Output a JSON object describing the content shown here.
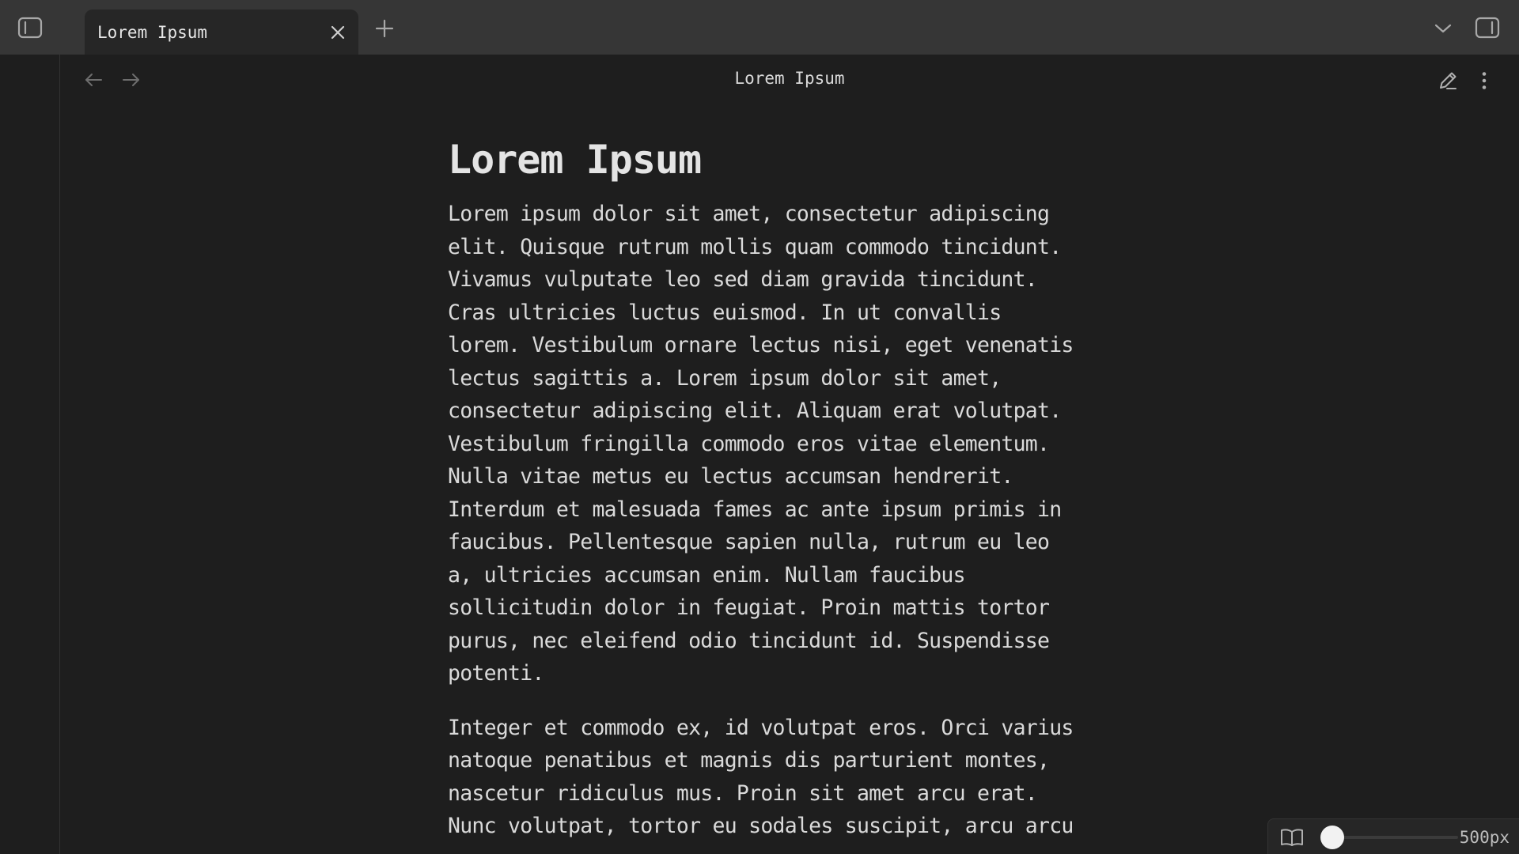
{
  "tabbar": {
    "tab_title": "Lorem Ipsum",
    "icons": {
      "sidebar_toggle": "sidebar-left-icon",
      "close": "close-icon",
      "new_tab": "plus-icon",
      "tab_list": "chevron-down-icon",
      "right_sidebar": "sidebar-right-icon"
    }
  },
  "view": {
    "title": "Lorem Ipsum",
    "icons": {
      "back": "arrow-left-icon",
      "forward": "arrow-right-icon",
      "edit": "pencil-icon",
      "more": "more-vertical-icon"
    }
  },
  "document": {
    "heading": "Lorem Ipsum",
    "paragraph1_lines": [
      "Lorem ipsum dolor sit amet, consectetur adipiscing",
      "elit. Quisque rutrum mollis quam commodo tincidunt.",
      "Vivamus vulputate leo sed diam gravida tincidunt.",
      "Cras ultricies luctus euismod. In ut convallis",
      "lorem. Vestibulum ornare lectus nisi, eget venenatis",
      "lectus sagittis a. Lorem ipsum dolor sit amet,",
      "consectetur adipiscing elit. Aliquam erat volutpat.",
      "Vestibulum fringilla commodo eros vitae elementum.",
      "Nulla vitae metus eu lectus accumsan hendrerit.",
      "Interdum et malesuada fames ac ante ipsum primis in",
      "faucibus. Pellentesque sapien nulla, rutrum eu leo",
      "a, ultricies accumsan enim. Nullam faucibus",
      "sollicitudin dolor in feugiat. Proin mattis tortor",
      "purus, nec eleifend odio tincidunt id. Suspendisse",
      "potenti."
    ],
    "paragraph2_lines": [
      "Integer et commodo ex, id volutpat eros. Orci varius",
      "natoque penatibus et magnis dis parturient montes,",
      "nascetur ridiculus mus. Proin sit amet arcu erat.",
      "Nunc volutpat, tortor eu sodales suscipit, arcu arcu"
    ]
  },
  "statusbar": {
    "width_value": "500px",
    "slider_fraction": 0.0,
    "icons": {
      "reading": "book-open-icon"
    }
  },
  "colors": {
    "background": "#1e1e1e",
    "tabbar": "#363636",
    "active_tab": "#262626",
    "text": "#dadada"
  }
}
